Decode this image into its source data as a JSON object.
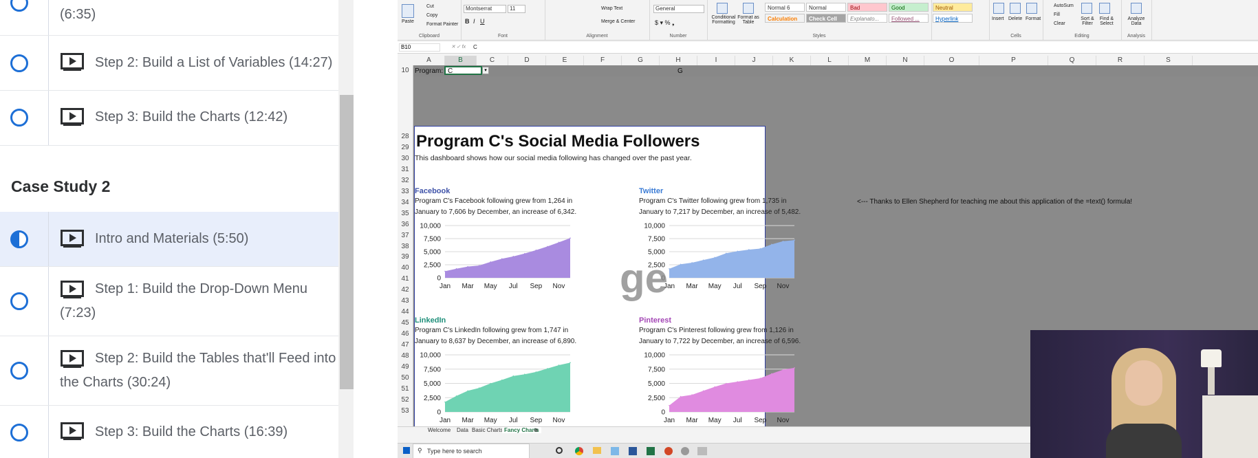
{
  "sidebar": {
    "lessons_top": [
      {
        "label": "(6:35)"
      },
      {
        "label": "Step 2: Build a List of Variables (14:27)"
      },
      {
        "label": "Step 3: Build the Charts (12:42)"
      }
    ],
    "section_title": "Case Study 2",
    "lessons": [
      {
        "label": "Intro and Materials (5:50)",
        "state": "in-progress"
      },
      {
        "label": "Step 1: Build the Drop-Down Menu (7:23)",
        "state": "not-started"
      },
      {
        "label": "Step 2: Build the Tables that'll Feed into the Charts (30:24)",
        "state": "not-started"
      },
      {
        "label": "Step 3: Build the Charts (16:39)",
        "state": "not-started"
      }
    ]
  },
  "ribbon": {
    "clipboard": {
      "paste": "Paste",
      "cut": "Cut",
      "copy": "Copy",
      "format_painter": "Format Painter",
      "group": "Clipboard"
    },
    "font": {
      "name": "Montserrat",
      "size": "11",
      "group": "Font"
    },
    "alignment": {
      "wrap": "Wrap Text",
      "merge": "Merge & Center",
      "group": "Alignment"
    },
    "number": {
      "format": "General",
      "group": "Number"
    },
    "styles": {
      "conditional": "Conditional Formatting",
      "format_table": "Format as Table",
      "cells": [
        {
          "label": "Normal 6",
          "bg": "#ffffff",
          "fg": "#000000"
        },
        {
          "label": "Normal",
          "bg": "#ffffff",
          "fg": "#000000"
        },
        {
          "label": "Bad",
          "bg": "#ffc7ce",
          "fg": "#9c0006"
        },
        {
          "label": "Good",
          "bg": "#c6efce",
          "fg": "#006100"
        },
        {
          "label": "Neutral",
          "bg": "#ffeb9c",
          "fg": "#9c5700"
        },
        {
          "label": "Calculation",
          "bg": "#f2f2f2",
          "fg": "#fa7d00"
        },
        {
          "label": "Check Cell",
          "bg": "#a5a5a5",
          "fg": "#ffffff"
        },
        {
          "label": "Explanato...",
          "bg": "#ffffff",
          "fg": "#7f7f7f"
        },
        {
          "label": "Followed ...",
          "bg": "#ffffff",
          "fg": "#954f72"
        },
        {
          "label": "Hyperlink",
          "bg": "#ffffff",
          "fg": "#0563c1"
        }
      ],
      "group": "Styles"
    },
    "cells": {
      "insert": "Insert",
      "delete": "Delete",
      "format": "Format",
      "group": "Cells"
    },
    "editing": {
      "autosum": "AutoSum",
      "fill": "Fill",
      "clear": "Clear",
      "sort": "Sort & Filter",
      "find": "Find & Select",
      "group": "Editing"
    },
    "analysis": {
      "analyze": "Analyze Data",
      "group": "Analysis"
    }
  },
  "formula_bar": {
    "name_box": "B10",
    "value": "C"
  },
  "columns": [
    "A",
    "B",
    "C",
    "D",
    "E",
    "F",
    "G",
    "H",
    "I",
    "J",
    "K",
    "L",
    "M",
    "N",
    "O",
    "P",
    "Q",
    "R",
    "S"
  ],
  "rows": [
    "10",
    "28",
    "29",
    "30",
    "31",
    "32",
    "33",
    "34",
    "35",
    "36",
    "37",
    "38",
    "39",
    "40",
    "41",
    "42",
    "43",
    "44",
    "45",
    "46",
    "47",
    "48",
    "49",
    "50",
    "51",
    "52",
    "53"
  ],
  "program_cell": {
    "label": "Program:",
    "value": "C",
    "g_value": "G"
  },
  "dashboard": {
    "title": "Program C's Social Media Followers",
    "subtitle": "This dashboard shows how our social media following has changed over the past year."
  },
  "chart_data": [
    {
      "type": "area",
      "title": "Facebook",
      "color": "#a98be0",
      "title_color": "#3e52a8",
      "description": "Program C's Facebook following grew from 1,264 in January to 7,606 by December, an increase of 6,342.",
      "x": [
        "Jan",
        "Feb",
        "Mar",
        "Apr",
        "May",
        "Jun",
        "Jul",
        "Aug",
        "Sep",
        "Oct",
        "Nov",
        "Dec"
      ],
      "x_ticks": [
        "Jan",
        "Mar",
        "May",
        "Jul",
        "Sep",
        "Nov"
      ],
      "y": [
        1264,
        1750,
        2150,
        2350,
        3050,
        3650,
        4100,
        4650,
        5300,
        6000,
        6800,
        7606
      ],
      "ylim": [
        0,
        10000
      ],
      "yticks": [
        "10,000",
        "7,500",
        "5,000",
        "2,500",
        "0"
      ]
    },
    {
      "type": "area",
      "title": "Twitter",
      "color": "#93b4ea",
      "title_color": "#3a7bd5",
      "description": "Program C's Twitter following grew from 1,735 in January to 7,217 by December, an increase of 5,482.",
      "x": [
        "Jan",
        "Feb",
        "Mar",
        "Apr",
        "May",
        "Jun",
        "Jul",
        "Aug",
        "Sep",
        "Oct",
        "Nov",
        "Dec"
      ],
      "x_ticks": [
        "Jan",
        "Mar",
        "May",
        "Jul",
        "Sep",
        "Nov"
      ],
      "y": [
        1735,
        2600,
        2900,
        3400,
        3900,
        4700,
        5100,
        5400,
        5600,
        6400,
        7000,
        7217
      ],
      "ylim": [
        0,
        10000
      ],
      "yticks": [
        "10,000",
        "7,500",
        "5,000",
        "2,500",
        "0"
      ]
    },
    {
      "type": "area",
      "title": "LinkedIn",
      "color": "#6fd3b3",
      "title_color": "#1f8f7a",
      "description": "Program C's LinkedIn following grew from 1,747 in January to 8,637 by December, an increase of 6,890.",
      "x": [
        "Jan",
        "Feb",
        "Mar",
        "Apr",
        "May",
        "Jun",
        "Jul",
        "Aug",
        "Sep",
        "Oct",
        "Nov",
        "Dec"
      ],
      "x_ticks": [
        "Jan",
        "Mar",
        "May",
        "Jul",
        "Sep",
        "Nov"
      ],
      "y": [
        1747,
        2800,
        3700,
        4200,
        5000,
        5600,
        6300,
        6600,
        7000,
        7600,
        8200,
        8637
      ],
      "ylim": [
        0,
        10000
      ],
      "yticks": [
        "10,000",
        "7,500",
        "5,000",
        "2,500",
        "0"
      ]
    },
    {
      "type": "area",
      "title": "Pinterest",
      "color": "#e08be0",
      "title_color": "#a347b5",
      "description": "Program C's Pinterest following grew from 1,126 in January to 7,722 by December, an increase of 6,596.",
      "x": [
        "Jan",
        "Feb",
        "Mar",
        "Apr",
        "May",
        "Jun",
        "Jul",
        "Aug",
        "Sep",
        "Oct",
        "Nov",
        "Dec"
      ],
      "x_ticks": [
        "Jan",
        "Mar",
        "May",
        "Jul",
        "Sep",
        "Nov"
      ],
      "y": [
        1126,
        2700,
        3000,
        3700,
        4400,
        5000,
        5300,
        5600,
        5900,
        6700,
        7400,
        7722
      ],
      "ylim": [
        0,
        10000
      ],
      "yticks": [
        "10,000",
        "7,500",
        "5,000",
        "2,500",
        "0"
      ]
    }
  ],
  "note": "<--- Thanks to Ellen Shepherd for teaching me about this application of the =text() formula!",
  "sheet_tabs": [
    "Welcome",
    "Data",
    "Basic Charts",
    "Fancy Charts"
  ],
  "taskbar": {
    "search_placeholder": "Type here to search"
  }
}
